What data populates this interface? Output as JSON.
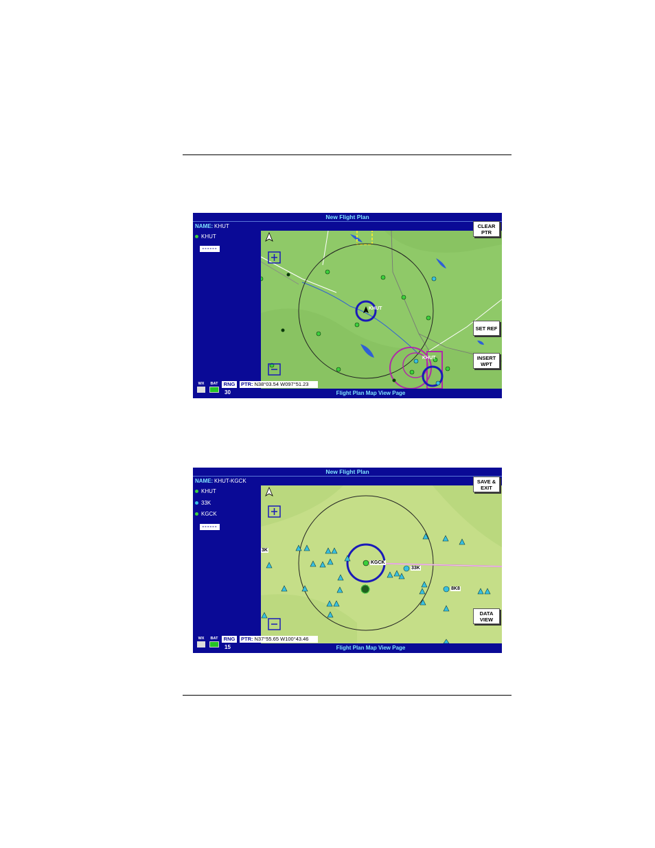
{
  "screen1": {
    "title": "New Flight Plan",
    "name_label": "NAME:",
    "name_value": "KHUT",
    "waypoints": [
      {
        "id": "KHUT",
        "color": "#3ccf3c"
      }
    ],
    "new_entry": "------",
    "buttons": {
      "top": "CLEAR PTR",
      "mid": "SET REF",
      "low": "INSERT WPT"
    },
    "status": {
      "wx_label": "WX",
      "bat_label": "BAT"
    },
    "rng_label": "RNG",
    "rng_value": "30",
    "ptr_label": "PTR:",
    "ptr_value": "N38°03.54 W097°51.23",
    "page_title": "Flight Plan Map View Page",
    "map_labels": [
      "KHUT",
      "KHUT"
    ]
  },
  "screen2": {
    "title": "New Flight Plan",
    "name_label": "NAME:",
    "name_value": "KHUT-KGCK",
    "waypoints": [
      {
        "id": "KHUT",
        "color": "#3ccf3c"
      },
      {
        "id": "33K",
        "color": "#39c0e0"
      },
      {
        "id": "KGCK",
        "color": "#3ccf3c"
      }
    ],
    "new_entry": "------",
    "buttons": {
      "top": "SAVE & EXIT",
      "low": "DATA VIEW"
    },
    "status": {
      "wx_label": "WX",
      "bat_label": "BAT"
    },
    "rng_label": "RNG",
    "rng_value": "15",
    "ptr_label": "PTR:",
    "ptr_value": "N37°55.65 W100°43.46",
    "page_title": "Flight Plan Map View Page",
    "map_labels": [
      "KGCK",
      "33K",
      "8K8",
      "3K"
    ]
  },
  "colors": {
    "screen_bg": "#0a0a96",
    "map_green": "#8fc968",
    "map_light": "#c5de88",
    "accent_cyan": "#7fe3ff",
    "route_magenta": "#b02aa8",
    "ring_blue": "#1a1ab8"
  }
}
